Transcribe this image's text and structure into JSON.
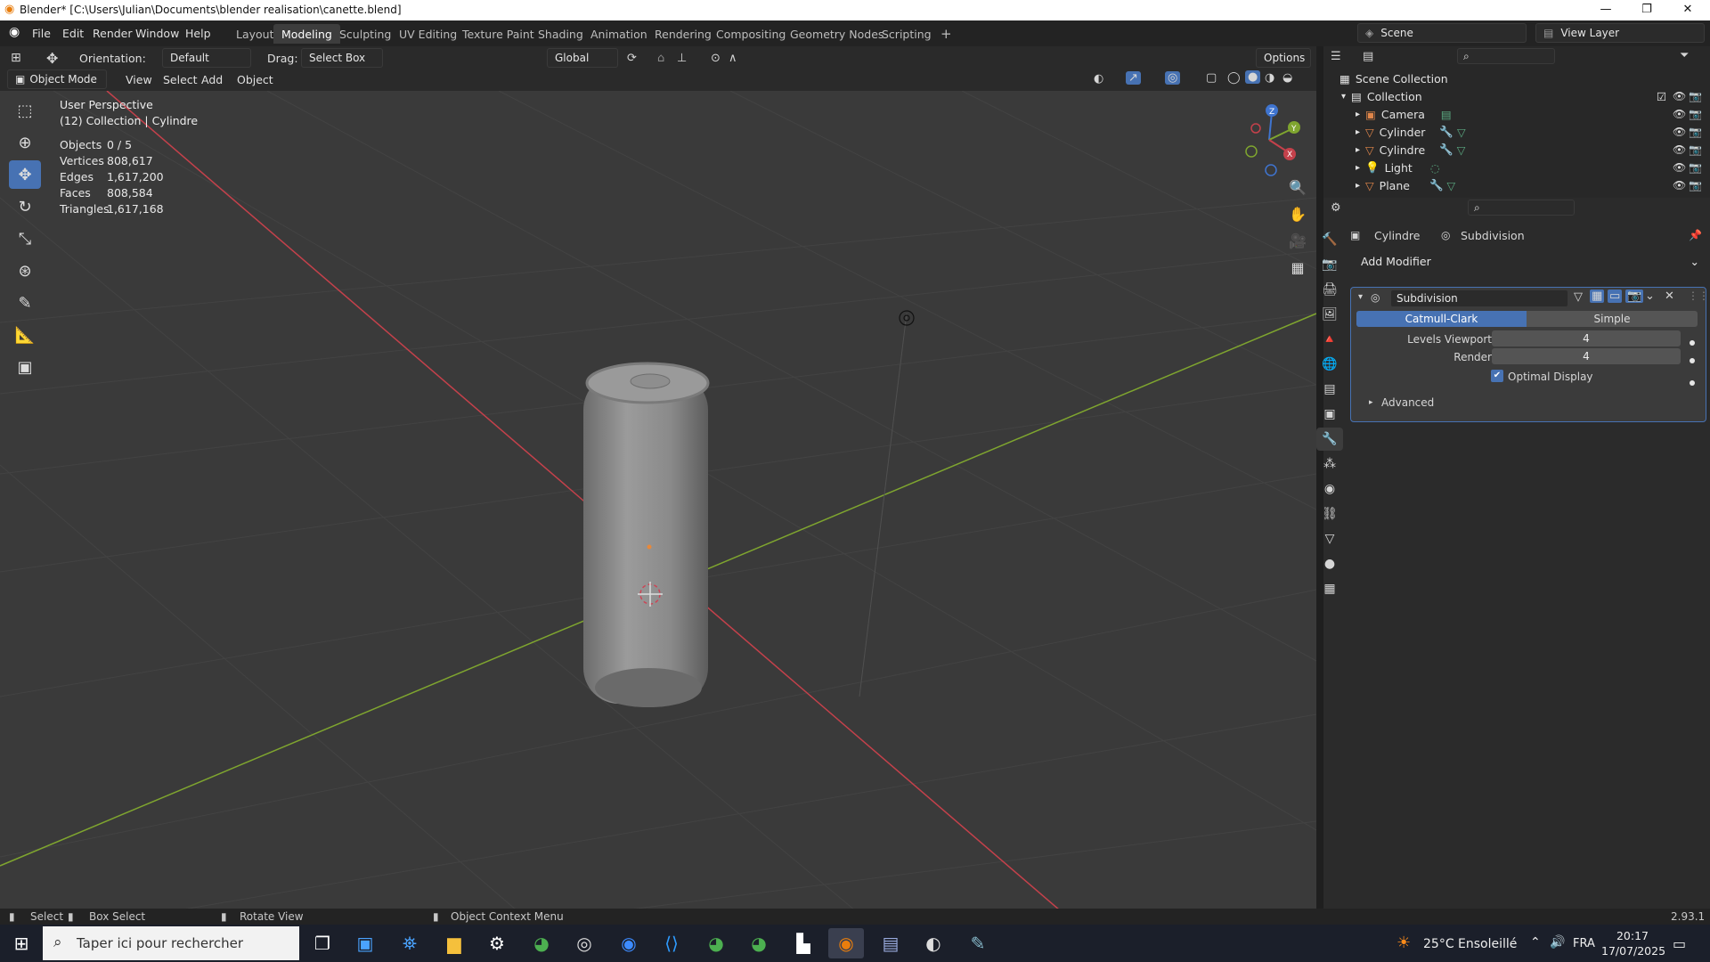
{
  "window": {
    "title": "Blender* [C:\\Users\\Julian\\Documents\\blender realisation\\canette.blend]",
    "minimize": "—",
    "maximize": "❐",
    "close": "✕"
  },
  "menu": {
    "file": "File",
    "edit": "Edit",
    "render": "Render",
    "window": "Window",
    "help": "Help"
  },
  "workspaces": [
    "Layout",
    "Modeling",
    "Sculpting",
    "UV Editing",
    "Texture Paint",
    "Shading",
    "Animation",
    "Rendering",
    "Compositing",
    "Geometry Nodes",
    "Scripting"
  ],
  "active_workspace": "Modeling",
  "scene": {
    "name": "Scene",
    "view_layer": "View Layer"
  },
  "tool_header": {
    "orientation_label": "Orientation:",
    "orientation_value": "Default",
    "drag_label": "Drag:",
    "drag_value": "Select Box",
    "transform_orientation": "Global",
    "options": "Options"
  },
  "viewport_header": {
    "mode": "Object Mode",
    "view": "View",
    "select": "Select",
    "add": "Add",
    "object": "Object"
  },
  "overlay_text": {
    "perspective": "User Perspective",
    "collection": "(12) Collection | Cylindre"
  },
  "stats": {
    "objects_label": "Objects",
    "objects": "0 / 5",
    "vertices_label": "Vertices",
    "vertices": "808,617",
    "edges_label": "Edges",
    "edges": "1,617,200",
    "faces_label": "Faces",
    "faces": "808,584",
    "triangles_label": "Triangles",
    "triangles": "1,617,168"
  },
  "gizmo": {
    "x": "X",
    "y": "Y",
    "z": "Z"
  },
  "outliner": {
    "root": "Scene Collection",
    "collection": "Collection",
    "items": [
      {
        "name": "Camera",
        "icon": "camera-icon",
        "color": "#e0864a"
      },
      {
        "name": "Cylinder",
        "icon": "mesh-icon",
        "color": "#e0864a"
      },
      {
        "name": "Cylindre",
        "icon": "mesh-icon",
        "color": "#e0864a"
      },
      {
        "name": "Light",
        "icon": "light-icon",
        "color": "#e0864a"
      },
      {
        "name": "Plane",
        "icon": "mesh-icon",
        "color": "#e0864a"
      }
    ]
  },
  "properties": {
    "object_name": "Cylindre",
    "modifier_breadcrumb": "Subdivision",
    "add_modifier": "Add Modifier",
    "modifier": {
      "name": "Subdivision",
      "type_catmull": "Catmull-Clark",
      "type_simple": "Simple",
      "levels_viewport_label": "Levels Viewport",
      "levels_viewport": "4",
      "render_label": "Render",
      "render": "4",
      "optimal_display": "Optimal Display",
      "advanced": "Advanced"
    }
  },
  "statusbar": {
    "select": "Select",
    "box_select": "Box Select",
    "rotate_view": "Rotate View",
    "context_menu": "Object Context Menu",
    "version": "2.93.1"
  },
  "taskbar": {
    "search_placeholder": "Taper ici pour rechercher",
    "weather": "25°C  Ensoleillé",
    "lang": "FRA",
    "time": "20:17",
    "date": "17/07/2025"
  },
  "colors": {
    "accent": "#4772b3",
    "x_axis": "#c4414b",
    "y_axis": "#7fa52f",
    "z_axis": "#3f74cf"
  }
}
